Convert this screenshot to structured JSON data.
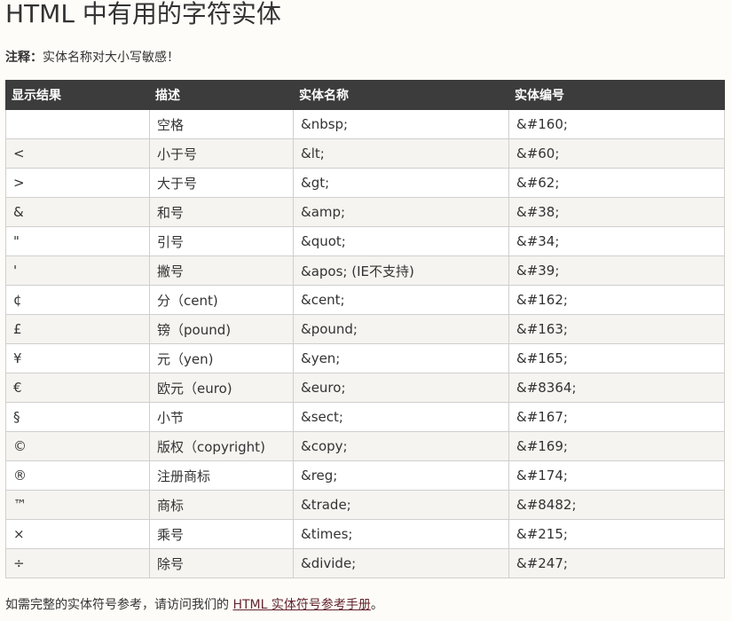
{
  "page": {
    "title": "HTML 中有用的字符实体",
    "note_label": "注释：",
    "note_text": "实体名称对大小写敏感！",
    "footer_prefix": "如需完整的实体符号参考，请访问我们的",
    "footer_link": "HTML 实体符号参考手册",
    "footer_suffix": "。"
  },
  "table": {
    "headers": [
      "显示结果",
      "描述",
      "实体名称",
      "实体编号"
    ],
    "rows": [
      [
        " ",
        "空格",
        "&nbsp;",
        "&#160;"
      ],
      [
        "<",
        "小于号",
        "&lt;",
        "&#60;"
      ],
      [
        ">",
        "大于号",
        "&gt;",
        "&#62;"
      ],
      [
        "&",
        "和号",
        "&amp;",
        "&#38;"
      ],
      [
        "\"",
        "引号",
        "&quot;",
        "&#34;"
      ],
      [
        "'",
        "撇号",
        "&apos; (IE不支持)",
        "&#39;"
      ],
      [
        "¢",
        "分（cent)",
        "&cent;",
        "&#162;"
      ],
      [
        "£",
        "镑（pound)",
        "&pound;",
        "&#163;"
      ],
      [
        "¥",
        "元（yen)",
        "&yen;",
        "&#165;"
      ],
      [
        "€",
        "欧元（euro)",
        "&euro;",
        "&#8364;"
      ],
      [
        "§",
        "小节",
        "&sect;",
        "&#167;"
      ],
      [
        "©",
        "版权（copyright)",
        "&copy;",
        "&#169;"
      ],
      [
        "®",
        "注册商标",
        "&reg;",
        "&#174;"
      ],
      [
        "™",
        "商标",
        "&trade;",
        "&#8482;"
      ],
      [
        "×",
        "乘号",
        "&times;",
        "&#215;"
      ],
      [
        "÷",
        "除号",
        "&divide;",
        "&#247;"
      ]
    ]
  },
  "colors": {
    "header_bg": "#3c3c3c",
    "link": "#64242e",
    "row_alt": "#f6f4f0"
  }
}
